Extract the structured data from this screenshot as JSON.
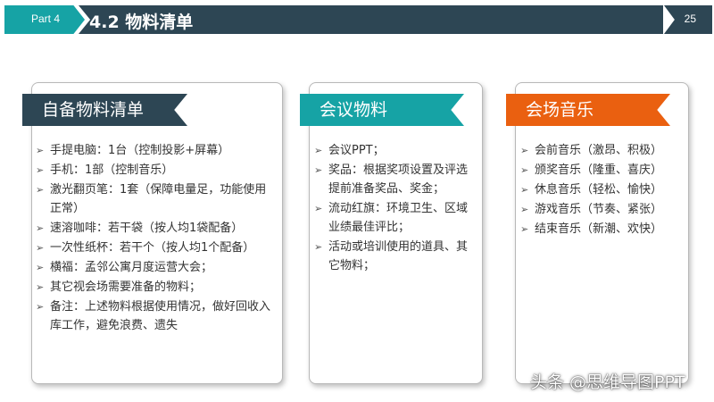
{
  "header": {
    "part_label": "Part 4",
    "title": "4.2 物料清单",
    "page_number": "25"
  },
  "sections": [
    {
      "title": "自备物料清单",
      "color": "#2d4654",
      "items": [
        "手提电脑：1台（控制投影+屏幕）",
        "手机：1部（控制音乐）",
        "激光翻页笔：1套（保障电量足，功能使用正常）",
        "速溶咖啡：若干袋（按人均1袋配备）",
        "一次性纸杯：若干个（按人均1个配备）",
        "横福：孟邻公寓月度运营大会；",
        "其它视会场需要准备的物料；",
        "备注：上述物料根据使用情况，做好回收入库工作，避免浪费、遗失"
      ]
    },
    {
      "title": "会议物料",
      "color": "#16a3a5",
      "items": [
        "会议PPT；",
        "奖品：根据奖项设置及评选提前准备奖品、奖金；",
        "流动红旗：环境卫生、区域业绩最佳评比；",
        "活动或培训使用的道具、其它物料；"
      ]
    },
    {
      "title": "会场音乐",
      "color": "#ea6010",
      "items": [
        "会前音乐（激昂、积极）",
        "颁奖音乐（隆重、喜庆）",
        "休息音乐（轻松、愉快）",
        "游戏音乐（节奏、紧张）",
        "结束音乐（新潮、欢快）"
      ]
    }
  ],
  "watermark": "头条 @思维导图PPT"
}
